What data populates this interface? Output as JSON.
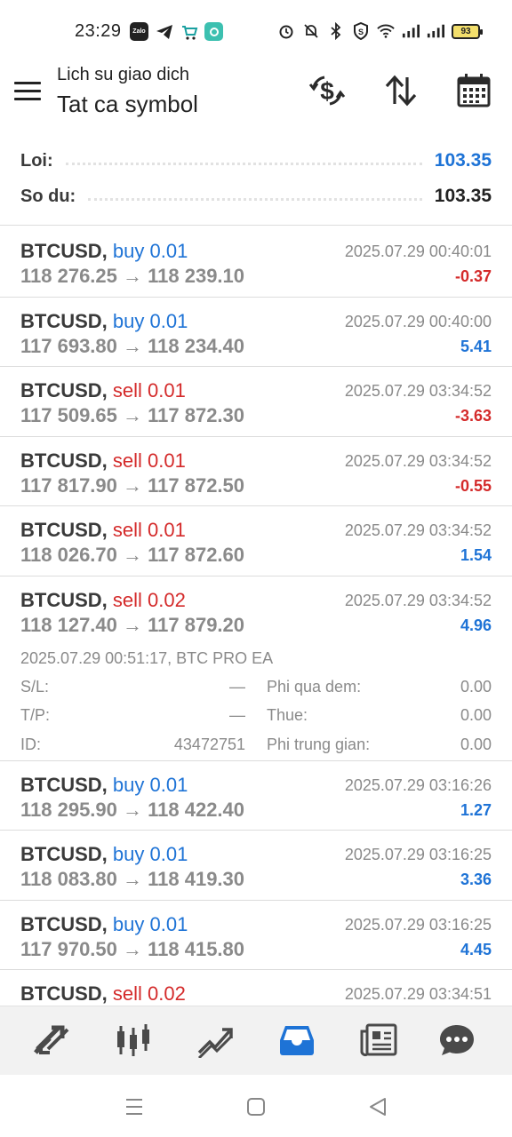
{
  "status_bar": {
    "time": "23:29",
    "apps": [
      "zalo-icon",
      "telegram-icon",
      "shop-icon",
      "chat-app-icon"
    ],
    "right_icons": [
      "alarm-icon",
      "mute-icon",
      "bluetooth-icon",
      "vpn-shield-icon",
      "wifi-icon",
      "signal-icon",
      "signal-icon"
    ],
    "battery": "93"
  },
  "header": {
    "subtitle": "Lich su giao dich",
    "title": "Tat ca symbol",
    "actions": [
      "currency-exchange-icon",
      "sort-icon",
      "calendar-icon"
    ]
  },
  "summary": {
    "profit_label": "Loi:",
    "profit_value": "103.35",
    "balance_label": "So du:",
    "balance_value": "103.35"
  },
  "deals": [
    {
      "symbol": "BTCUSD,",
      "direction": "buy 0.01",
      "type": "buy",
      "prices": "118 276.25 → 118 239.10",
      "time": "2025.07.29 00:40:01",
      "profit": "-0.37",
      "sign": "neg"
    },
    {
      "symbol": "BTCUSD,",
      "direction": "buy 0.01",
      "type": "buy",
      "prices": "117 693.80 → 118 234.40",
      "time": "2025.07.29 00:40:00",
      "profit": "5.41",
      "sign": "pos"
    },
    {
      "symbol": "BTCUSD,",
      "direction": "sell 0.01",
      "type": "sell",
      "prices": "117 509.65 → 117 872.30",
      "time": "2025.07.29 03:34:52",
      "profit": "-3.63",
      "sign": "neg"
    },
    {
      "symbol": "BTCUSD,",
      "direction": "sell 0.01",
      "type": "sell",
      "prices": "117 817.90 → 117 872.50",
      "time": "2025.07.29 03:34:52",
      "profit": "-0.55",
      "sign": "neg"
    },
    {
      "symbol": "BTCUSD,",
      "direction": "sell 0.01",
      "type": "sell",
      "prices": "118 026.70 → 117 872.60",
      "time": "2025.07.29 03:34:52",
      "profit": "1.54",
      "sign": "pos"
    },
    {
      "symbol": "BTCUSD,",
      "direction": "sell 0.02",
      "type": "sell",
      "prices": "118 127.40 → 117 879.20",
      "time": "2025.07.29 03:34:52",
      "profit": "4.96",
      "sign": "pos",
      "expanded": true,
      "open_info": "2025.07.29 00:51:17, BTC PRO EA",
      "details": [
        {
          "label1": "S/L:",
          "value1": "—",
          "label2": "Phi qua dem:",
          "value2": "0.00"
        },
        {
          "label1": "T/P:",
          "value1": "—",
          "label2": "Thue:",
          "value2": "0.00"
        },
        {
          "label1": "ID:",
          "value1": "43472751",
          "label2": "Phi trung gian:",
          "value2": "0.00"
        }
      ]
    },
    {
      "symbol": "BTCUSD,",
      "direction": "buy 0.01",
      "type": "buy",
      "prices": "118 295.90 → 118 422.40",
      "time": "2025.07.29 03:16:26",
      "profit": "1.27",
      "sign": "pos"
    },
    {
      "symbol": "BTCUSD,",
      "direction": "buy 0.01",
      "type": "buy",
      "prices": "118 083.80 → 118 419.30",
      "time": "2025.07.29 03:16:25",
      "profit": "3.36",
      "sign": "pos"
    },
    {
      "symbol": "BTCUSD,",
      "direction": "buy 0.01",
      "type": "buy",
      "prices": "117 970.50 → 118 415.80",
      "time": "2025.07.29 03:16:25",
      "profit": "4.45",
      "sign": "pos"
    },
    {
      "symbol": "BTCUSD,",
      "direction": "sell 0.02",
      "type": "sell",
      "prices": "",
      "time": "2025.07.29 03:34:51",
      "profit": "",
      "sign": "pos"
    }
  ],
  "bottom_nav": [
    "quotes-icon",
    "chart-icon",
    "trade-icon",
    "history-icon",
    "news-icon",
    "messages-icon"
  ],
  "bottom_nav_active": "history-icon",
  "colors": {
    "buy": "#1e73d6",
    "sell": "#d42a2a",
    "active_tab": "#1e73d6"
  },
  "system_nav": [
    "recents-icon",
    "home-icon",
    "back-icon"
  ]
}
